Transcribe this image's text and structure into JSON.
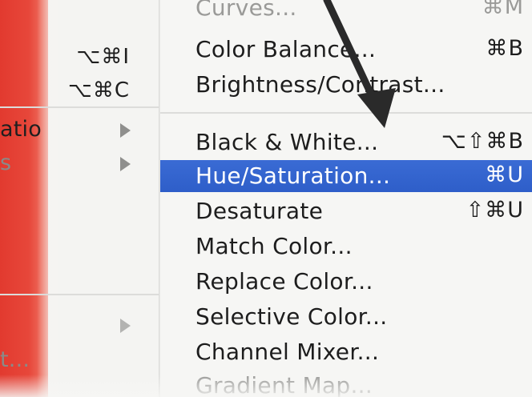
{
  "parent_menu": {
    "items": [
      {
        "label": "",
        "shortcut": "⌥⌘I",
        "arrow": false
      },
      {
        "label": "",
        "shortcut": "⌥⌘C",
        "arrow": false
      },
      {
        "label": "atio",
        "shortcut": "",
        "arrow": true
      },
      {
        "label": "s",
        "shortcut": "",
        "arrow": true
      },
      {
        "label": "",
        "shortcut": "",
        "arrow": true
      },
      {
        "label": "t...",
        "shortcut": "",
        "arrow": false
      }
    ]
  },
  "submenu": {
    "items": [
      {
        "label": "Curves...",
        "shortcut": "⌘M"
      },
      {
        "label": "Color Balance...",
        "shortcut": "⌘B"
      },
      {
        "label": "Brightness/Contrast...",
        "shortcut": ""
      },
      {
        "label": "Black & White...",
        "shortcut": "⌥⇧⌘B"
      },
      {
        "label": "Hue/Saturation...",
        "shortcut": "⌘U"
      },
      {
        "label": "Desaturate",
        "shortcut": "⇧⌘U"
      },
      {
        "label": "Match Color...",
        "shortcut": ""
      },
      {
        "label": "Replace Color...",
        "shortcut": ""
      },
      {
        "label": "Selective Color...",
        "shortcut": ""
      },
      {
        "label": "Channel Mixer...",
        "shortcut": ""
      },
      {
        "label": "Gradient Map...",
        "shortcut": ""
      }
    ],
    "highlighted_index": 4
  },
  "colors": {
    "highlight": "#2e5ec9",
    "backdrop_red": "#e23a2f",
    "annotation_arrow": "#2a2a2a"
  }
}
